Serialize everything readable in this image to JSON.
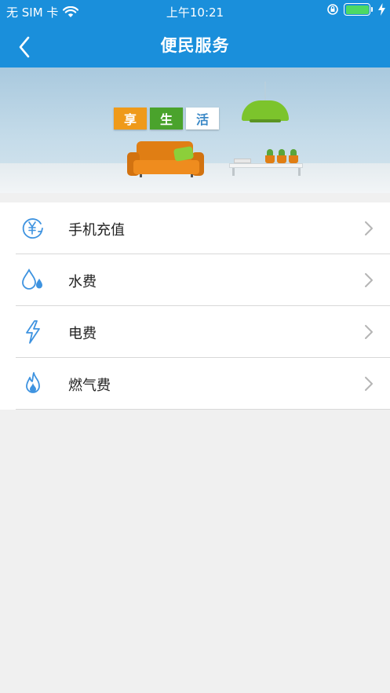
{
  "status_bar": {
    "carrier": "无 SIM 卡",
    "time": "上午10:21"
  },
  "nav": {
    "title": "便民服务",
    "back_icon": "chevron-left-icon"
  },
  "banner": {
    "tiles": [
      "享",
      "生",
      "活"
    ]
  },
  "services": [
    {
      "label": "手机充值",
      "icon": "mobile-recharge-icon"
    },
    {
      "label": "水费",
      "icon": "water-drop-icon"
    },
    {
      "label": "电费",
      "icon": "lightning-icon"
    },
    {
      "label": "燃气费",
      "icon": "flame-icon"
    }
  ],
  "colors": {
    "header": "#1a8fdb",
    "icon": "#3e93e0",
    "background": "#f0f0f0"
  }
}
